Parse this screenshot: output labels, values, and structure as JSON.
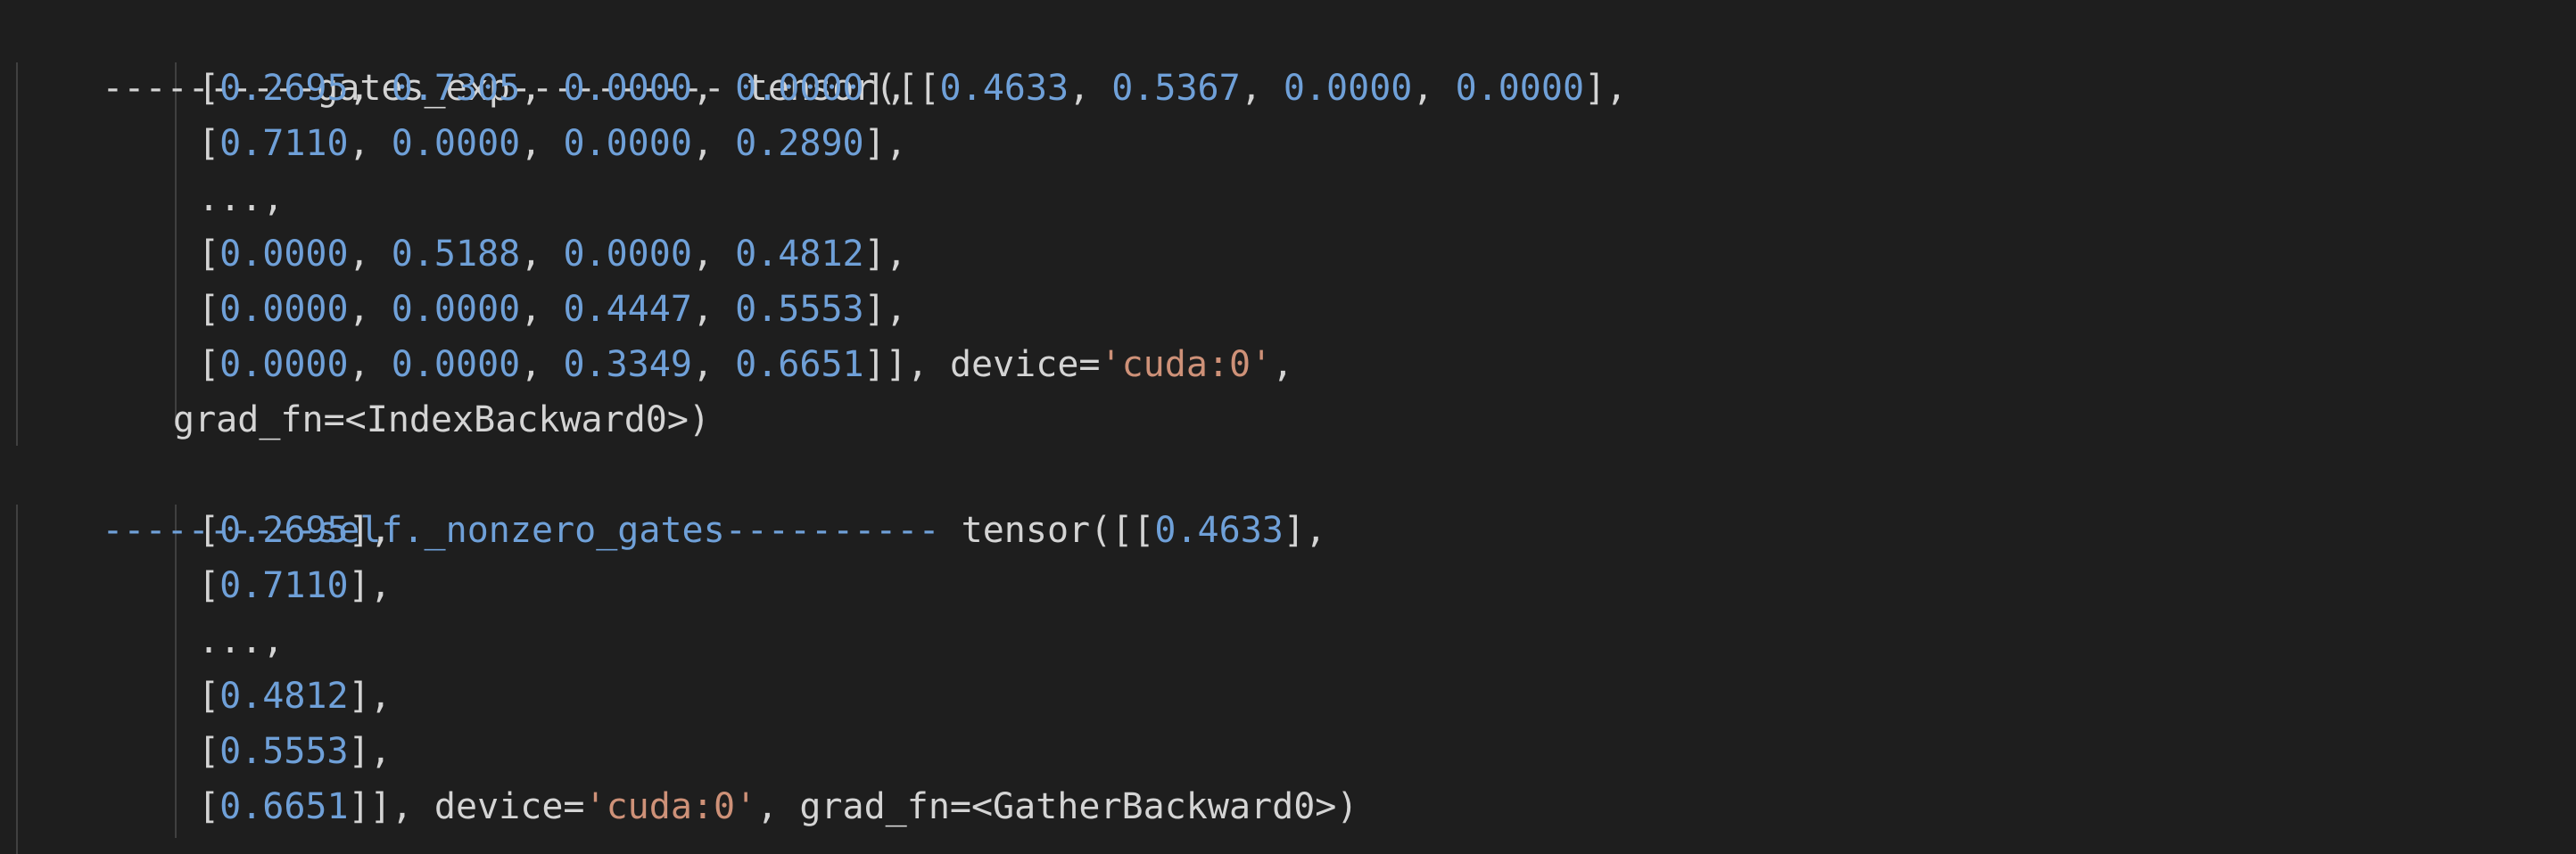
{
  "output": {
    "block1": {
      "header": {
        "label": "----------gates_exp----------",
        "call": " tensor([["
      },
      "rows": [
        {
          "first": true,
          "values": [
            "0.4633",
            "0.5367",
            "0.0000",
            "0.0000"
          ],
          "suffix": "],"
        },
        {
          "first": false,
          "values": [
            "0.2695",
            "0.7305",
            "0.0000",
            "0.0000"
          ],
          "suffix": "],"
        },
        {
          "first": false,
          "values": [
            "0.7110",
            "0.0000",
            "0.0000",
            "0.2890"
          ],
          "suffix": "],"
        },
        {
          "ellipsis": "...,"
        },
        {
          "first": false,
          "values": [
            "0.0000",
            "0.5188",
            "0.0000",
            "0.4812"
          ],
          "suffix": "],"
        },
        {
          "first": false,
          "values": [
            "0.0000",
            "0.0000",
            "0.4447",
            "0.5553"
          ],
          "suffix": "],"
        },
        {
          "first": false,
          "values": [
            "0.0000",
            "0.0000",
            "0.3349",
            "0.6651"
          ],
          "suffix": "]], device="
        }
      ],
      "device_value": "'cuda:0'",
      "trailing_comma": ",",
      "grad_fn": "grad_fn=<IndexBackward0>)"
    },
    "block2": {
      "header": {
        "label": "----------self._nonzero_gates----------",
        "call": " tensor([["
      },
      "first_value": "0.4633",
      "first_suffix": "],",
      "rows": [
        {
          "value": "0.2695",
          "suffix": "],"
        },
        {
          "value": "0.7110",
          "suffix": "],"
        },
        {
          "ellipsis": "...,"
        },
        {
          "value": "0.4812",
          "suffix": "],"
        },
        {
          "value": "0.5553",
          "suffix": "],"
        }
      ],
      "last_value": "0.6651",
      "last_prefix": "]], device=",
      "device_value": "'cuda:0'",
      "grad_fn": ", grad_fn=<GatherBackward0>)"
    }
  },
  "colors": {
    "background": "#1e1e1e",
    "text": "#d4d4d4",
    "number": "#6fa0d8",
    "string": "#ce9178"
  }
}
